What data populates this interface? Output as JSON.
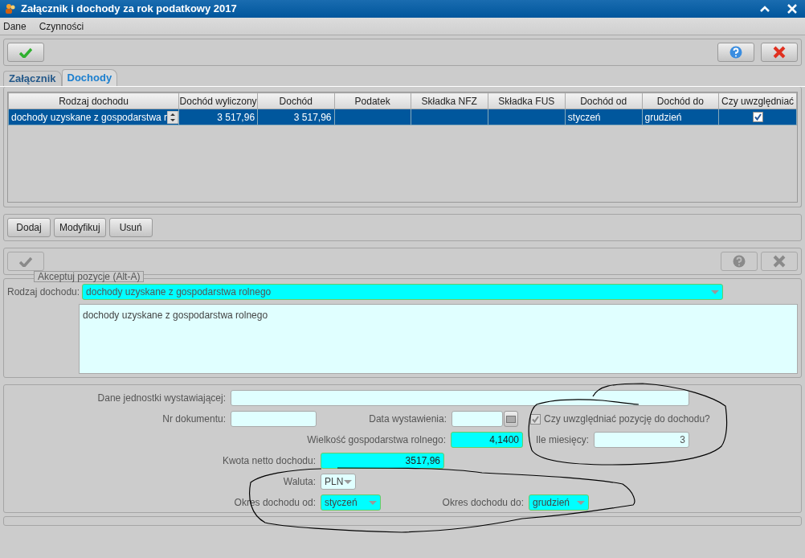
{
  "window": {
    "title": "Załącznik i dochody za rok podatkowy 2017"
  },
  "menu": [
    "Dane",
    "Czynności"
  ],
  "tabs": [
    {
      "label": "Załącznik",
      "selected": false
    },
    {
      "label": "Dochody",
      "selected": true
    }
  ],
  "table": {
    "columns": [
      "Rodzaj dochodu",
      "Dochód wyliczony",
      "Dochód",
      "Podatek",
      "Składka NFZ",
      "Składka FUS",
      "Dochód od",
      "Dochód do",
      "Czy uwzględniać"
    ],
    "rows": [
      {
        "selected": true,
        "income_type": "dochody uzyskane z gospodarstwa r",
        "computed_income": "3 517,96",
        "income": "3 517,96",
        "income_from": "styczeń",
        "income_to": "grudzień",
        "included": true
      }
    ]
  },
  "list_buttons": [
    "Dodaj",
    "Modyfikuj",
    "Usuń"
  ],
  "item_toolbar": {
    "disabled": true,
    "tooltip": "Akceptuj pozycje (Alt-A)"
  },
  "income_type": {
    "label": "Rodzaj dochodu:",
    "value": "dochody uzyskane z gospodarstwa rolnego",
    "required": true,
    "description": "dochody uzyskane z gospodarstwa rolnego"
  },
  "form": {
    "issuer": {
      "label": "Dane jednostki wystawiającej:",
      "required": false
    },
    "doc_number": {
      "label": "Nr dokumentu:",
      "required": false
    },
    "issue_date": {
      "label": "Data wystawienia:",
      "required": false
    },
    "include": {
      "label": "Czy uwzględniać pozycję do dochodu?",
      "checked": true,
      "disabled": true
    },
    "farm_size": {
      "label": "Wielkość gospodarstwa rolnego:",
      "value": "4,1400",
      "required": true
    },
    "months": {
      "label": "Ile miesięcy:",
      "value": "3",
      "required": false
    },
    "net_income": {
      "label": "Kwota netto dochodu:",
      "value": "3517,96",
      "required": true
    },
    "currency": {
      "label": "Waluta:",
      "value": "PLN",
      "required": false
    },
    "period_from": {
      "label": "Okres dochodu od:",
      "value": "styczeń",
      "required": true
    },
    "period_to": {
      "label": "Okres dochodu do:",
      "value": "grudzień",
      "required": true
    }
  }
}
